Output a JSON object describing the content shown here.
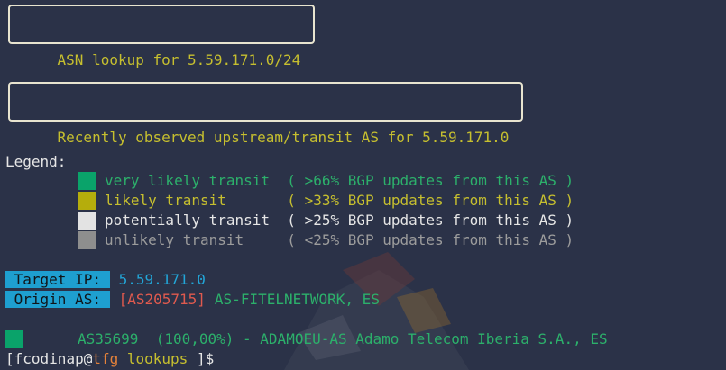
{
  "colors": {
    "very_likely": "#0aa36a",
    "likely": "#b5ad0c",
    "potentially": "#e3e3e3",
    "unlikely": "#8e8e8e",
    "accent_blue": "#1e9fd0"
  },
  "header_box": "ASN lookup for 5.59.171.0/24",
  "upstream_box": "Recently observed upstream/transit AS for 5.59.171.0",
  "legend": {
    "title": "Legend:",
    "items": [
      {
        "name": "very likely transit  ",
        "desc": "( >66% BGP updates from this AS )"
      },
      {
        "name": "likely transit       ",
        "desc": "( >33% BGP updates from this AS )"
      },
      {
        "name": "potentially transit  ",
        "desc": "( >25% BGP updates from this AS )"
      },
      {
        "name": "unlikely transit     ",
        "desc": "( <25% BGP updates from this AS )"
      }
    ]
  },
  "target": {
    "ip_label": " Target IP: ",
    "ip_value": "5.59.171.0",
    "origin_label": " Origin AS: ",
    "origin_asn": "[AS205715]",
    "origin_name": "AS-FITELNETWORK, ES"
  },
  "upstream_row": "AS35699  (100,00%) - ADAMOEU-AS Adamo Telecom Iberia S.A., ES",
  "prompt": {
    "open": "[",
    "user": "fcodinap",
    "at": "@",
    "host": "tfg",
    "dir": " lookups ",
    "close": "]$"
  }
}
